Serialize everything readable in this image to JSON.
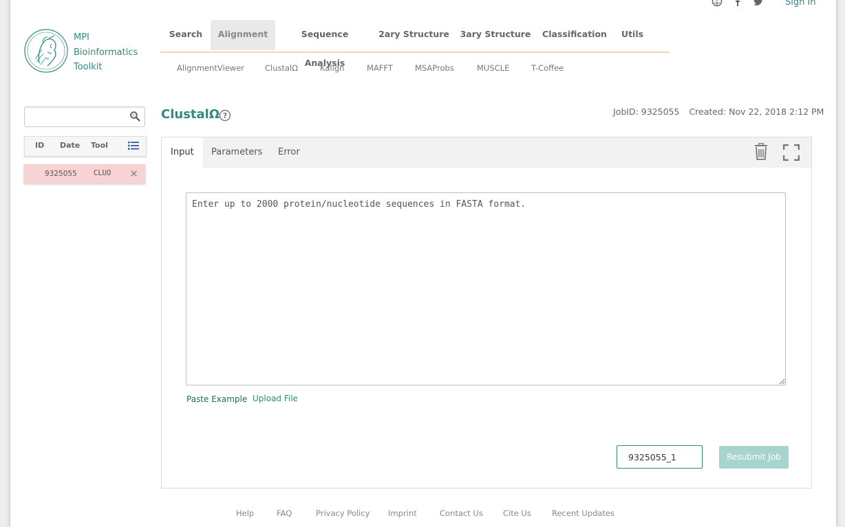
{
  "header": {
    "social_icons": [
      "globe-icon",
      "facebook-icon",
      "twitter-icon"
    ],
    "signin_label": "Sign In"
  },
  "logo": {
    "line1": "MPI",
    "line2": "Bioinformatics",
    "line3": "Toolkit"
  },
  "nav": {
    "items": [
      "Search",
      "Alignment",
      "Sequence Analysis",
      "2ary Structure",
      "3ary Structure",
      "Classification",
      "Utils"
    ],
    "active": "Alignment"
  },
  "subnav": {
    "items": [
      "AlignmentViewer",
      "ClustalΩ",
      "Kalign",
      "MAFFT",
      "MSAProbs",
      "MUSCLE",
      "T-Coffee"
    ]
  },
  "sidebar": {
    "search_placeholder": "",
    "columns": [
      "ID",
      "Date",
      "Tool"
    ],
    "jobs": [
      {
        "id": "9325055",
        "tool": "CLUO"
      }
    ]
  },
  "tool": {
    "title": "ClustalΩ",
    "jobid_label": "JobID: 9325055",
    "created_label": "Created: Nov 22, 2018 2:12 PM"
  },
  "tabs": [
    "Input",
    "Parameters",
    "Error"
  ],
  "input": {
    "placeholder": "Enter up to 2000 protein/nucleotide sequences in FASTA format.",
    "paste_example": "Paste Example",
    "upload_file": "Upload File",
    "jobname_value": "9325055_1",
    "resubmit_label": "Resubmit Job"
  },
  "colors": {
    "accent": "#2e8b7e",
    "job_highlight": "#f8d3d3",
    "button_disabled": "#a8d4cf"
  },
  "footer": {
    "links": [
      "Help",
      "FAQ",
      "Privacy Policy",
      "Imprint",
      "Contact Us",
      "Cite Us",
      "Recent Updates"
    ]
  }
}
